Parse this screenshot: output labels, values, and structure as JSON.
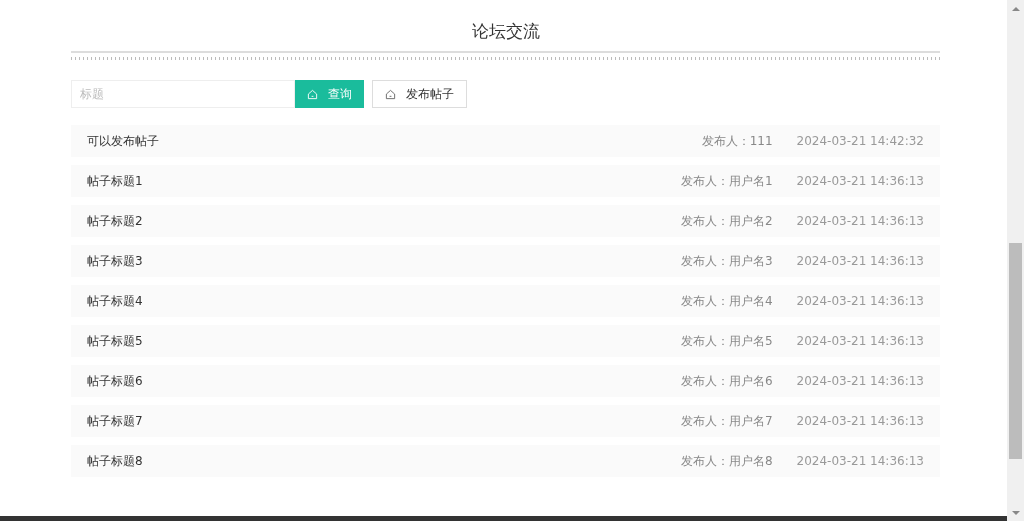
{
  "page": {
    "title": "论坛交流"
  },
  "search": {
    "placeholder": "标题",
    "query_button": "查询",
    "post_button": "发布帖子"
  },
  "posts": [
    {
      "title": "可以发布帖子",
      "author": "发布人：111",
      "time": "2024-03-21 14:42:32"
    },
    {
      "title": "帖子标题1",
      "author": "发布人：用户名1",
      "time": "2024-03-21 14:36:13"
    },
    {
      "title": "帖子标题2",
      "author": "发布人：用户名2",
      "time": "2024-03-21 14:36:13"
    },
    {
      "title": "帖子标题3",
      "author": "发布人：用户名3",
      "time": "2024-03-21 14:36:13"
    },
    {
      "title": "帖子标题4",
      "author": "发布人：用户名4",
      "time": "2024-03-21 14:36:13"
    },
    {
      "title": "帖子标题5",
      "author": "发布人：用户名5",
      "time": "2024-03-21 14:36:13"
    },
    {
      "title": "帖子标题6",
      "author": "发布人：用户名6",
      "time": "2024-03-21 14:36:13"
    },
    {
      "title": "帖子标题7",
      "author": "发布人：用户名7",
      "time": "2024-03-21 14:36:13"
    },
    {
      "title": "帖子标题8",
      "author": "发布人：用户名8",
      "time": "2024-03-21 14:36:13"
    }
  ]
}
